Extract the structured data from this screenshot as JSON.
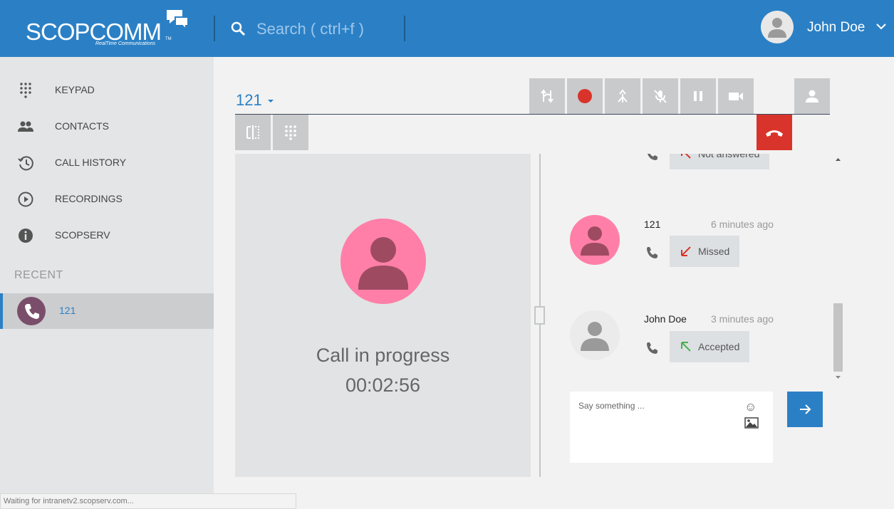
{
  "header": {
    "logo_text": "SCOPCOMM",
    "logo_tagline": "RealTime Communications",
    "logo_tm": "TM",
    "search_placeholder": "Search ( ctrl+f )",
    "user_name": "John Doe",
    "brand_color": "#2b80c5"
  },
  "sidebar": {
    "items": [
      {
        "label": "KEYPAD",
        "icon": "keypad-icon"
      },
      {
        "label": "CONTACTS",
        "icon": "contacts-icon"
      },
      {
        "label": "CALL HISTORY",
        "icon": "history-icon"
      },
      {
        "label": "RECORDINGS",
        "icon": "play-icon"
      },
      {
        "label": "SCOPSERV",
        "icon": "info-icon"
      }
    ],
    "recent_title": "RECENT",
    "recent": [
      {
        "label": "121",
        "icon": "phone-icon"
      }
    ]
  },
  "call": {
    "number": "121",
    "status": "Call in progress",
    "timer": "00:02:56",
    "toolbar": [
      "transfer-icon",
      "record-icon",
      "merge-icon",
      "mute-icon",
      "pause-icon",
      "video-icon",
      "contact-icon"
    ],
    "toolbar2": [
      "split-view-icon",
      "dialpad-icon"
    ],
    "hangup_color": "#d9342b"
  },
  "chat": {
    "messages": [
      {
        "name": "",
        "time": "",
        "status": "Not answered",
        "arrow_color": "#d9342b"
      },
      {
        "name": "121",
        "time": "6 minutes ago",
        "status": "Missed",
        "arrow_color": "#d9342b"
      },
      {
        "name": "John Doe",
        "time": "3 minutes ago",
        "status": "Accepted",
        "arrow_color": "#4caf50"
      }
    ],
    "compose_placeholder": "Say something ...",
    "emoji_glyph": "☺"
  },
  "statusbar": {
    "text": "Waiting for intranetv2.scopserv.com..."
  }
}
